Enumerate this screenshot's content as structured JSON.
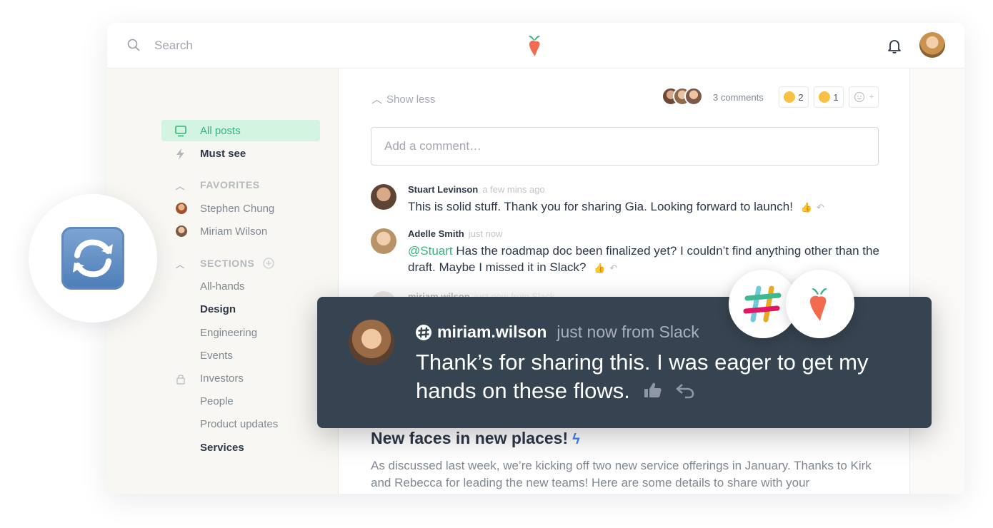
{
  "topbar": {
    "search_placeholder": "Search",
    "logo_icon": "carrot-logo-icon",
    "notification_icon": "bell-icon"
  },
  "sidebar": {
    "primary": [
      {
        "label": "All posts",
        "icon": "monitor-icon",
        "active": true
      },
      {
        "label": "Must see",
        "icon": "lightning-icon",
        "active": false
      }
    ],
    "favorites_heading": "FAVORITES",
    "favorites": [
      {
        "label": "Stephen Chung"
      },
      {
        "label": "Miriam Wilson"
      }
    ],
    "sections_heading": "SECTIONS",
    "sections": [
      {
        "label": "All-hands",
        "bold": false
      },
      {
        "label": "Design",
        "bold": true
      },
      {
        "label": "Engineering",
        "bold": false
      },
      {
        "label": "Events",
        "bold": false
      },
      {
        "label": "Investors",
        "bold": false,
        "locked": true
      },
      {
        "label": "People",
        "bold": false
      },
      {
        "label": "Product updates",
        "bold": false
      },
      {
        "label": "Services",
        "bold": true
      }
    ]
  },
  "thread": {
    "show_less": "Show less",
    "comments_count": "3 comments",
    "reactions": [
      {
        "emoji": "relieved-face",
        "count": "2"
      },
      {
        "emoji": "thinking-face",
        "count": "1"
      }
    ],
    "comment_placeholder": "Add a comment…",
    "comments": [
      {
        "author": "Stuart Levinson",
        "time": "a few mins ago",
        "text": "This is solid stuff. Thank you for sharing Gia. Looking forward to launch!"
      },
      {
        "author": "Adelle Smith",
        "time": "just now",
        "mention": "@Stuart",
        "text": " Has the roadmap doc been finalized yet? I couldn’t find anything other than the draft. Maybe I missed it in Slack?"
      },
      {
        "author": "miriam.wilson",
        "time": "just now from Slack"
      }
    ]
  },
  "post": {
    "title": "New faces in new places!",
    "body": "As discussed last week, we’re kicking off two new service offerings in January. Thanks to Kirk and Rebecca for leading the new teams! Here are some details to share with your"
  },
  "popup": {
    "author": "miriam.wilson",
    "time": "just now from Slack",
    "text": "Thank’s for sharing this. I was eager to get my hands on these flows."
  },
  "colors": {
    "accent_green": "#36b37e",
    "popup_bg": "#364350",
    "active_bg": "#d3f4e1"
  }
}
